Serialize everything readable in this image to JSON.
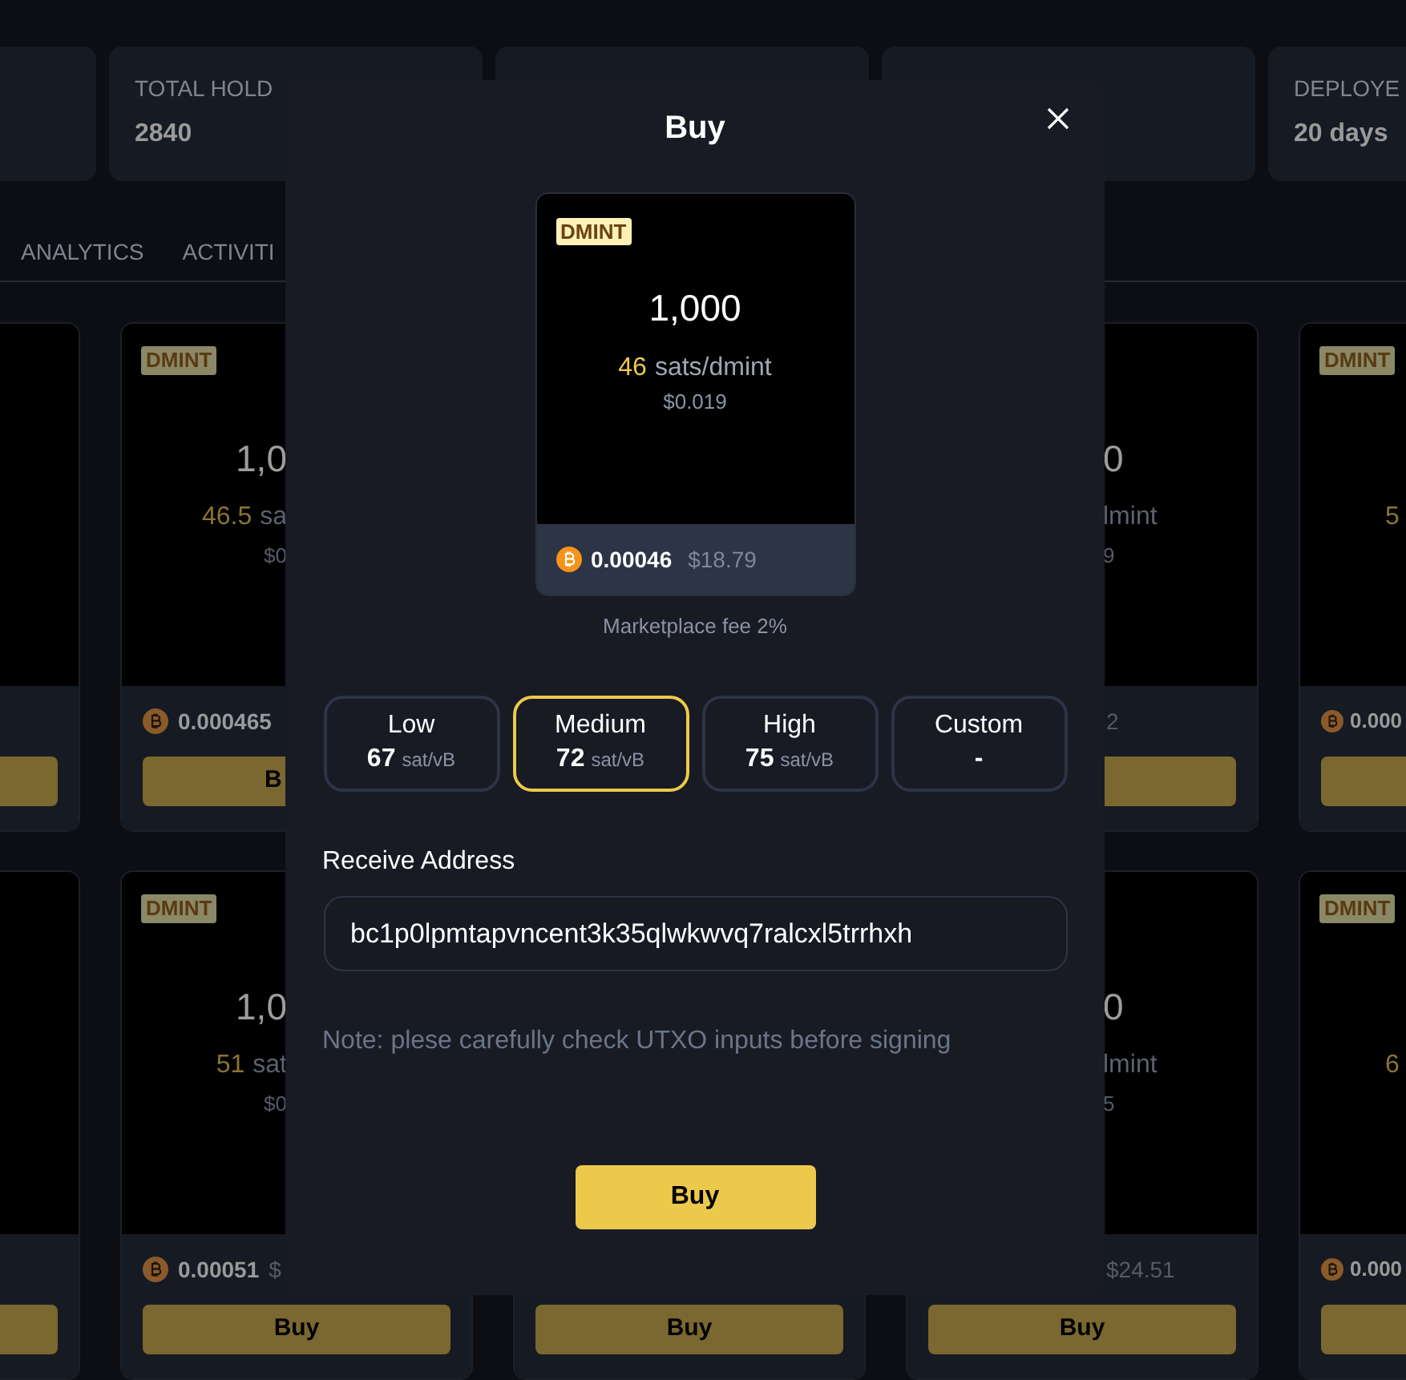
{
  "stat_cards": [
    {
      "label": "TOTAL HOLD",
      "value": "2840"
    },
    {
      "label": "DEPLOYE",
      "value": "20 days"
    }
  ],
  "tabs": [
    "ANALYTICS",
    "ACTIVITI"
  ],
  "listing_rows": [
    {
      "cards": [
        {
          "kind": "clipped_right",
          "badge": "DMINT",
          "amount": "1,0",
          "price": "46.5",
          "unit": "sa",
          "usd": "$0",
          "btc": "0.000465",
          "button": "B"
        },
        {
          "kind": "clipped_left",
          "amount": "0",
          "unit": "lmint",
          "usd": "9",
          "usd_total": "2"
        },
        {
          "kind": "window_edge",
          "badge": "DMINT",
          "price": "5",
          "btc": "0.000"
        }
      ]
    },
    {
      "cards": [
        {
          "kind": "clipped_right",
          "badge": "DMINT",
          "amount": "1,0",
          "price": "51",
          "unit": "sat",
          "usd": "$0",
          "btc": "0.00051",
          "usd_total": "$",
          "button": "Buy"
        },
        {
          "kind": "bottom_only",
          "button": "Buy"
        },
        {
          "kind": "clipped_left",
          "amount": "0",
          "unit": "lmint",
          "usd": "5",
          "usd_total": "$24.51",
          "button": "Buy"
        },
        {
          "kind": "window_edge",
          "badge": "DMINT",
          "price": "6",
          "btc": "0.000"
        }
      ]
    }
  ],
  "dialog": {
    "title": "Buy",
    "preview": {
      "badge": "DMINT",
      "amount": "1,000",
      "price": "46",
      "unit": "sats/dmint",
      "usd": "$0.019",
      "btc": "0.00046",
      "usd_total": "$18.79"
    },
    "fee_note": "Marketplace fee 2%",
    "fee_options": [
      {
        "label": "Low",
        "rate": "67",
        "unit": "sat/vB",
        "selected": false
      },
      {
        "label": "Medium",
        "rate": "72",
        "unit": "sat/vB",
        "selected": true
      },
      {
        "label": "High",
        "rate": "75",
        "unit": "sat/vB",
        "selected": false
      },
      {
        "label": "Custom",
        "rate": "-",
        "selected": false
      }
    ],
    "address_label": "Receive Address",
    "address": "bc1p0lpmtapvncent3k35qlwkwvq7ralcxl5trrhxh",
    "note": "Note: plese carefully check UTXO inputs before signing",
    "buy_button": "Buy"
  }
}
